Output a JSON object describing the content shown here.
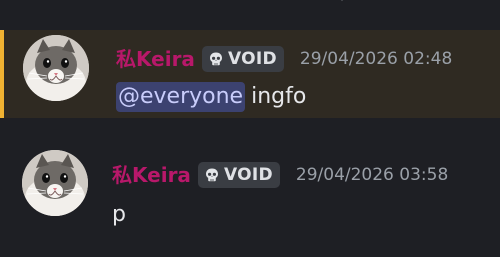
{
  "messages": [
    {
      "username": "私Keira",
      "tag": "VOID",
      "timestamp": "29/04/2026 02:48",
      "mention": "@everyone",
      "text": "ingfo",
      "highlighted": true
    },
    {
      "username": "私Keira",
      "tag": "VOID",
      "timestamp": "29/04/2026 03:58",
      "text": "p",
      "highlighted": false
    }
  ],
  "colors": {
    "background": "#1e1f24",
    "highlight_background": "#2f2a22",
    "highlight_bar": "#f0b232",
    "username": "#b8186a",
    "mention_background": "#3c4270",
    "mention_text": "#c9cdfb",
    "timestamp": "#9aa0a8"
  },
  "icons": {
    "tag_icon": "skull-icon",
    "avatar": "cat-avatar"
  }
}
